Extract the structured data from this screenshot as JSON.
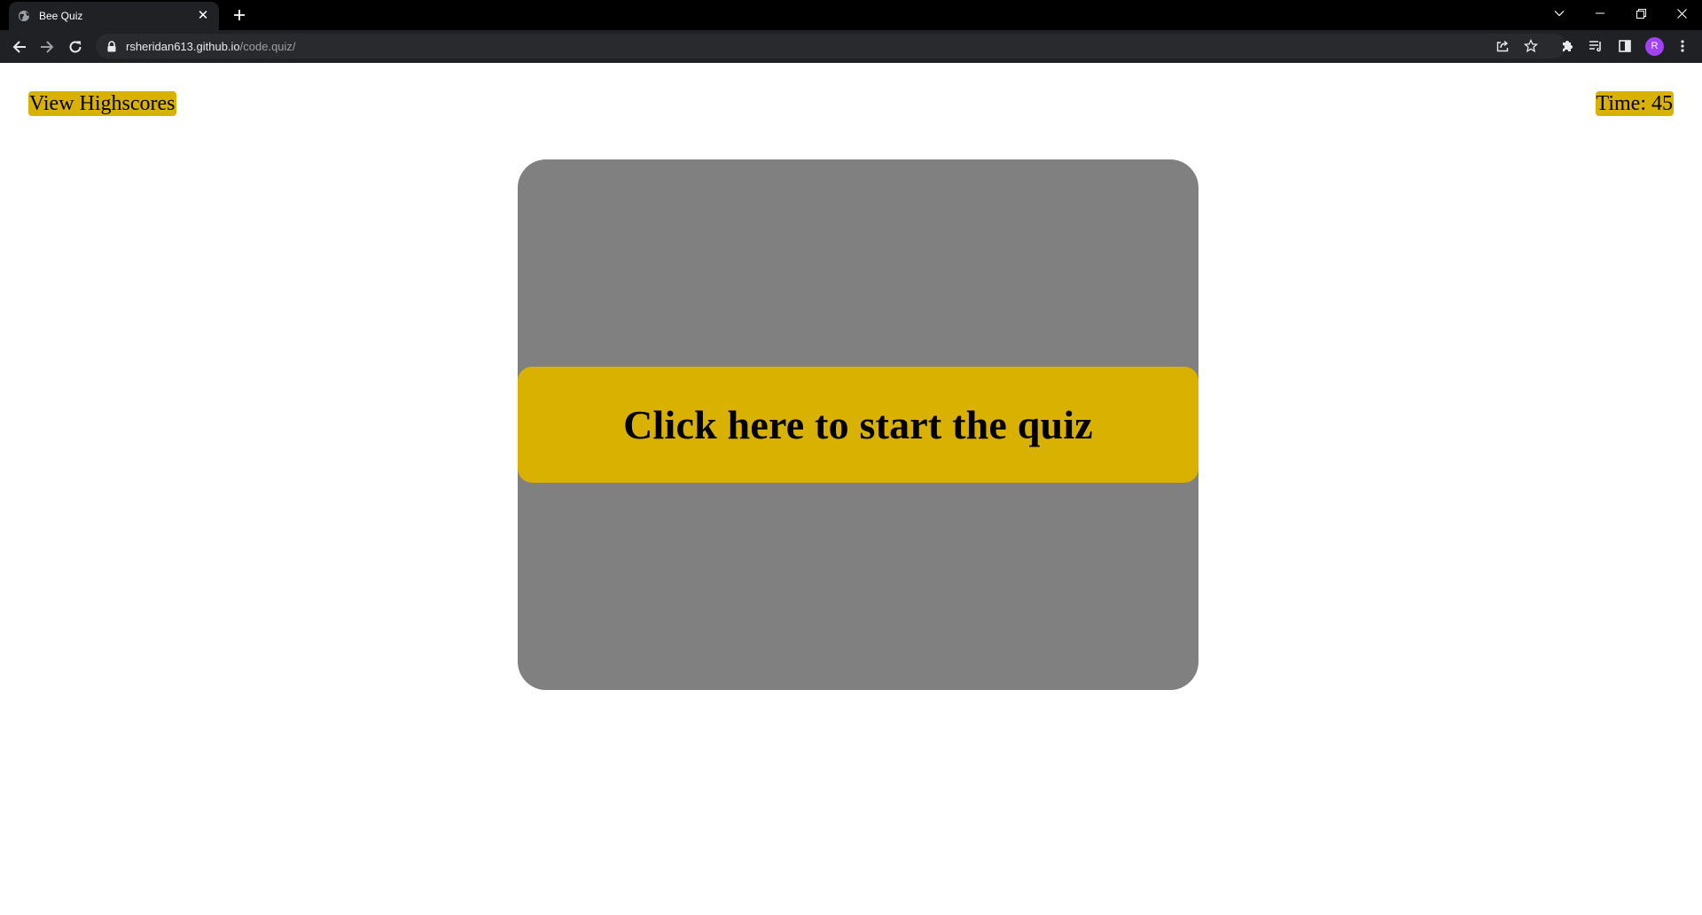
{
  "browser": {
    "tab": {
      "title": "Bee Quiz",
      "favicon": "globe-icon",
      "close_glyph": "✕"
    },
    "new_tab_icon": "plus-icon",
    "window_controls": [
      "chevron-down-icon",
      "minimize-icon",
      "restore-icon",
      "close-icon"
    ],
    "toolbar": {
      "back_icon": "arrow-left-icon",
      "forward_icon": "arrow-right-icon",
      "reload_icon": "reload-icon",
      "lock_icon": "lock-icon",
      "url_host": "rsheridan613.github.io",
      "url_path": "/code.quiz/",
      "right_icons": [
        "share-icon",
        "star-icon",
        "puzzle-icon",
        "reading-list-icon",
        "side-panel-icon"
      ],
      "profile_initial": "R",
      "menu_icon": "kebab-menu-icon"
    }
  },
  "page": {
    "highscores_label": "View Highscores",
    "timer_label": "Time: 45",
    "start_button_label": "Click here to start the quiz"
  },
  "colors": {
    "accent_gold": "#d9b100",
    "card_gray": "#808080",
    "browser_frame": "#202124",
    "tabstrip": "#000000",
    "profile": "#a142f4"
  }
}
